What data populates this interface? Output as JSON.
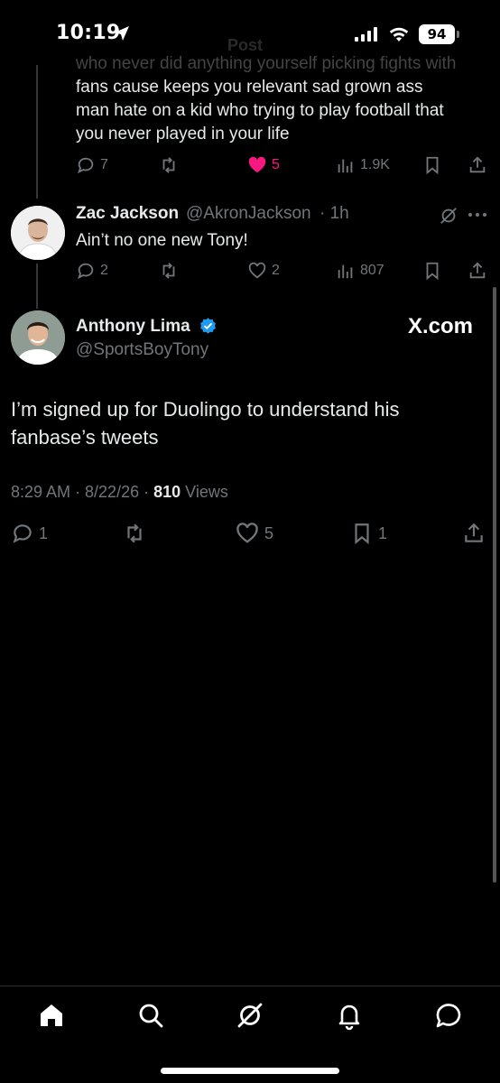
{
  "status_bar": {
    "time": "10:19",
    "battery": "94",
    "faded_title": "Post"
  },
  "reply1": {
    "cutoff_line": "who never did anything yourself picking fights with",
    "text_lines": [
      "fans cause keeps you relevant sad grown ass",
      "man hate on a kid who trying to play football that",
      "you never played in your life"
    ],
    "replies": "7",
    "likes": "5",
    "views": "1.9K"
  },
  "reply2": {
    "name": "Zac Jackson",
    "handle": "@AkronJackson",
    "time": "· 1h",
    "text": "Ain’t no one new Tony!",
    "replies": "2",
    "likes": "2",
    "views": "807"
  },
  "main_tweet": {
    "name": "Anthony Lima",
    "handle": "@SportsBoyTony",
    "watermark": "X.com",
    "text_lines": [
      "I’m signed up for Duolingo to understand his",
      "fanbase’s tweets"
    ],
    "time": "8:29 AM · 8/22/26 · ",
    "views_count": "810",
    "views_label": " Views",
    "replies": "1",
    "likes": "5",
    "bookmarks": "1"
  },
  "colors": {
    "background": "#000000",
    "text": "#e7e9ea",
    "muted": "#71767b",
    "like_pink": "#f91880",
    "verified_blue": "#1d9bf0"
  },
  "tabs": [
    "home-icon",
    "search-icon",
    "grok-icon",
    "notifications-icon",
    "messages-icon"
  ]
}
